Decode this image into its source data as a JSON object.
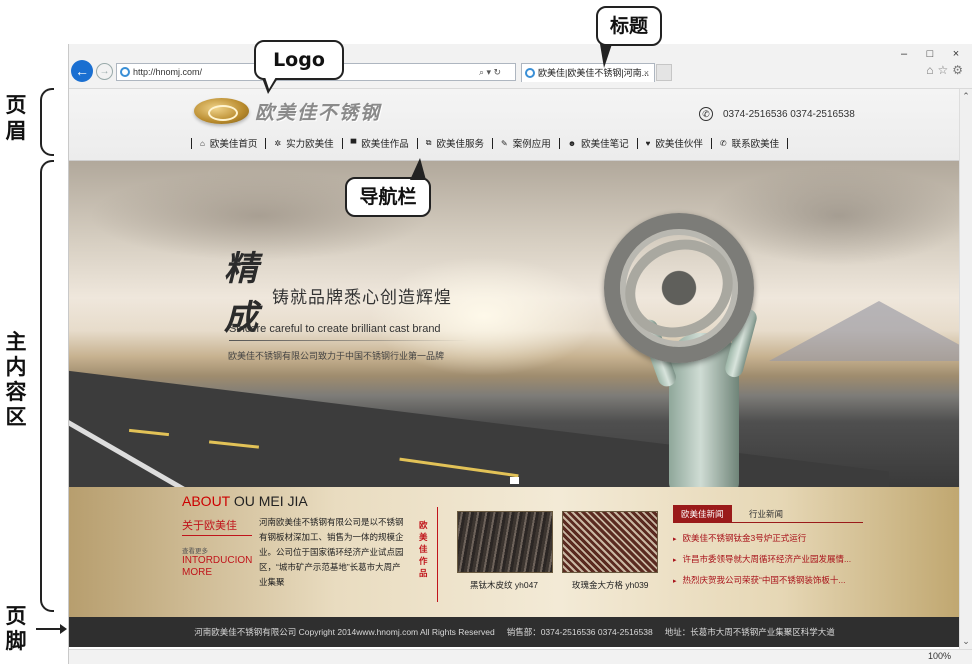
{
  "annotations": {
    "header_label": "页眉",
    "main_label": "主内容区",
    "footer_label": "页脚",
    "logo_label": "Logo",
    "title_label": "标题",
    "navbar_label": "导航栏"
  },
  "browser": {
    "url": "http://hnomj.com/",
    "address_tools": "⌕ ▾ ↻",
    "tab_title": "欧美佳|欧美佳不锈钢|河南...",
    "tab_close": "×",
    "window_controls": [
      "–",
      "□",
      "×"
    ],
    "toolbar_icons": [
      "home-icon",
      "star-icon",
      "gear-icon"
    ],
    "zoom": "100%"
  },
  "site": {
    "logo_text": "欧美佳不锈钢",
    "phone": "0374-2516536  0374-2516538",
    "nav": [
      {
        "icon": "home-icon",
        "glyph": "⌂",
        "label": "欧美佳首页"
      },
      {
        "icon": "gears-icon",
        "glyph": "✲",
        "label": "实力欧美佳"
      },
      {
        "icon": "monitor-icon",
        "glyph": "▀",
        "label": "欧美佳作品"
      },
      {
        "icon": "window-icon",
        "glyph": "⧉",
        "label": "欧美佳服务"
      },
      {
        "icon": "edit-icon",
        "glyph": "✎",
        "label": "案例应用"
      },
      {
        "icon": "users-icon",
        "glyph": "☻",
        "label": "欧美佳笔记"
      },
      {
        "icon": "heart-icon",
        "glyph": "♥",
        "label": "欧美佳伙伴"
      },
      {
        "icon": "phone-icon",
        "glyph": "✆",
        "label": "联系欧美佳"
      }
    ],
    "banner": {
      "big_chars": "精成",
      "headline": "铸就品牌悉心创造辉煌",
      "english": "Sincere careful to create brilliant cast brand",
      "subline": "欧美佳不锈钢有限公司致力于中国不锈钢行业第一品牌"
    },
    "about": {
      "title_red": "ABOUT",
      "title_rest": " OU MEI JIA",
      "label": "关于欧美佳",
      "more_small": "查看更多",
      "more": "INTORDUCION MORE",
      "text": "河南欧美佳不锈钢有限公司是以不锈钢有钢板材深加工、销售为一体的规模企业。公司位于国家循环经济产业试点园区，“城市矿产示范基地”长葛市大周产业集聚"
    },
    "works_label": "欧美佳作品",
    "products": [
      {
        "name": "黑钛木皮纹 yh047"
      },
      {
        "name": "玫瑰金大方格 yh039"
      }
    ],
    "news": {
      "tabs": [
        "欧美佳新闻",
        "行业新闻"
      ],
      "items": [
        "欧美佳不锈钢钛金3号炉正式运行",
        "许昌市委领导就大周循环经济产业园发展情...",
        "热烈庆贺我公司荣获“中国不锈钢装饰板十..."
      ]
    },
    "footer": {
      "copyright": "河南欧美佳不锈钢有限公司 Copyright 2014www.hnomj.com All Rights Reserved",
      "sales": "销售部：0374-2516536 0374-2516538",
      "address": "地址：长葛市大周不锈钢产业集聚区科学大道"
    }
  }
}
